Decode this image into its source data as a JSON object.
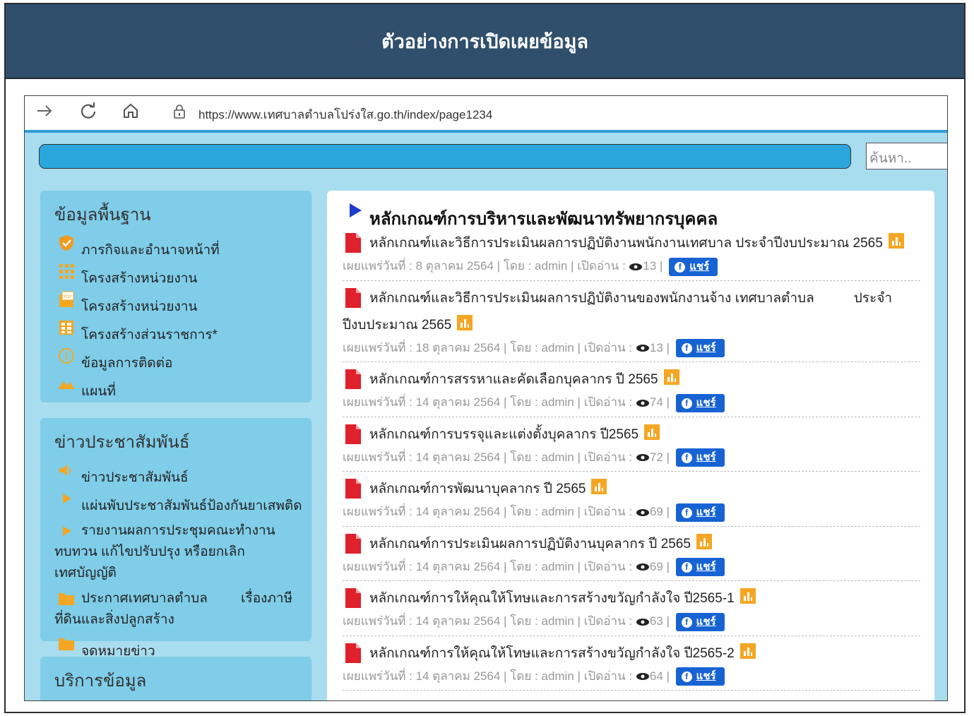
{
  "page": {
    "title": "ตัวอย่างการเปิดเผยข้อมูล"
  },
  "browser": {
    "url": "https://www.เทศบาลตำบลโปร่งใส.go.th/index/page1234",
    "search_placeholder": "ค้นหา.."
  },
  "sidebar": {
    "basic": {
      "title": "ข้อมูลพื้นฐาน",
      "items": [
        {
          "label": "ภารกิจและอำนาจหน้าที่",
          "icon": "shield-check-icon"
        },
        {
          "label": "โครงสร้างหน่วยงาน",
          "icon": "grid-dots-icon"
        },
        {
          "label": "โครงสร้างหน่วยงาน",
          "icon": "pdf-file-icon"
        },
        {
          "label": "โครงสร้างส่วนราชการ*",
          "icon": "table-icon"
        },
        {
          "label": "ข้อมูลการติดต่อ",
          "icon": "info-icon"
        },
        {
          "label": "แผนที่",
          "icon": "mountain-icon"
        }
      ]
    },
    "news": {
      "title": "ข่าวประชาสัมพันธ์",
      "items": [
        {
          "label": "ข่าวประชาสัมพันธ์",
          "icon": "speaker-icon"
        },
        {
          "label": "แผ่นพับประชาสัมพันธ์ป้องกันยาเสพติด",
          "icon": "play-icon"
        },
        {
          "line1": "รายงานผลการประชุมคณะทำงาน",
          "line2": "ทบทวน แก้ไขปรับปรุง หรือยกเลิกเทศบัญญัติ",
          "icon": "play-icon"
        },
        {
          "line1": "ประกาศเทศบาลตำบล",
          "line1b": "เรื่องภาษี",
          "line2": "ที่ดินและสิ่งปลูกสร้าง",
          "icon": "folder-icon"
        },
        {
          "label": "จดหมายข่าว",
          "icon": "folder-icon"
        }
      ]
    },
    "services": {
      "title": "บริการข้อมูล"
    }
  },
  "main": {
    "heading": "หลักเกณฑ์การบริหารและพัฒนาทรัพยากรบุคคล",
    "share_label": "แชร์",
    "entries": [
      {
        "title": "หลักเกณฑ์และวิธีการประเมินผลการปฏิบัติงานพนักงานเทศบาล ประจำปีงบประมาณ 2565",
        "meta": "เผยแพร่วันที่ : 8 ตุลาคม 2564 | โดย : admin | เปิดอ่าน :",
        "views": "13"
      },
      {
        "title": "หลักเกณฑ์และวิธีการประเมินผลการปฏิบัติงานของพนักงานจ้าง เทศบาลตำบล",
        "title_b": "ประจำ",
        "title2": "ปีงบประมาณ 2565",
        "meta": "เผยแพร่วันที่ : 18 ตุลาคม 2564 | โดย : admin | เปิดอ่าน :",
        "views": "13"
      },
      {
        "title": "หลักเกณฑ์การสรรหาและคัดเลือกบุคลากร ปี 2565",
        "meta": "เผยแพร่วันที่ : 14 ตุลาคม 2564 | โดย : admin | เปิดอ่าน :",
        "views": "74"
      },
      {
        "title": "หลักเกณฑ์การบรรจุและแต่งตั้งบุคลากร ปี2565",
        "meta": "เผยแพร่วันที่ : 14 ตุลาคม 2564 | โดย : admin | เปิดอ่าน :",
        "views": "72"
      },
      {
        "title": "หลักเกณฑ์การพัฒนาบุคลากร ปี 2565",
        "meta": "เผยแพร่วันที่ : 14 ตุลาคม 2564 | โดย : admin | เปิดอ่าน :",
        "views": "69"
      },
      {
        "title": "หลักเกณฑ์การประเมินผลการปฏิบัติงานบุคลากร ปี 2565",
        "meta": "เผยแพร่วันที่ : 14 ตุลาคม 2564 | โดย : admin | เปิดอ่าน :",
        "views": "69"
      },
      {
        "title": "หลักเกณฑ์การให้คุณให้โทษและการสร้างขวัญกำลังใจ ปี2565-1",
        "meta": "เผยแพร่วันที่ : 14 ตุลาคม 2564 | โดย : admin | เปิดอ่าน :",
        "views": "63"
      },
      {
        "title": "หลักเกณฑ์การให้คุณให้โทษและการสร้างขวัญกำลังใจ ปี2565-2",
        "meta": "เผยแพร่วันที่ : 14 ตุลาคม 2564 | โดย : admin | เปิดอ่าน :",
        "views": "64"
      }
    ]
  },
  "colors": {
    "header_bg": "#2f4f6c",
    "sidebar_bg": "#7fcde8",
    "page_bg": "#a8dcef",
    "accent_blue": "#2aa6dd",
    "share_bg": "#1763d4",
    "pdf_red": "#e0202a",
    "chart_orange": "#f5a623"
  }
}
